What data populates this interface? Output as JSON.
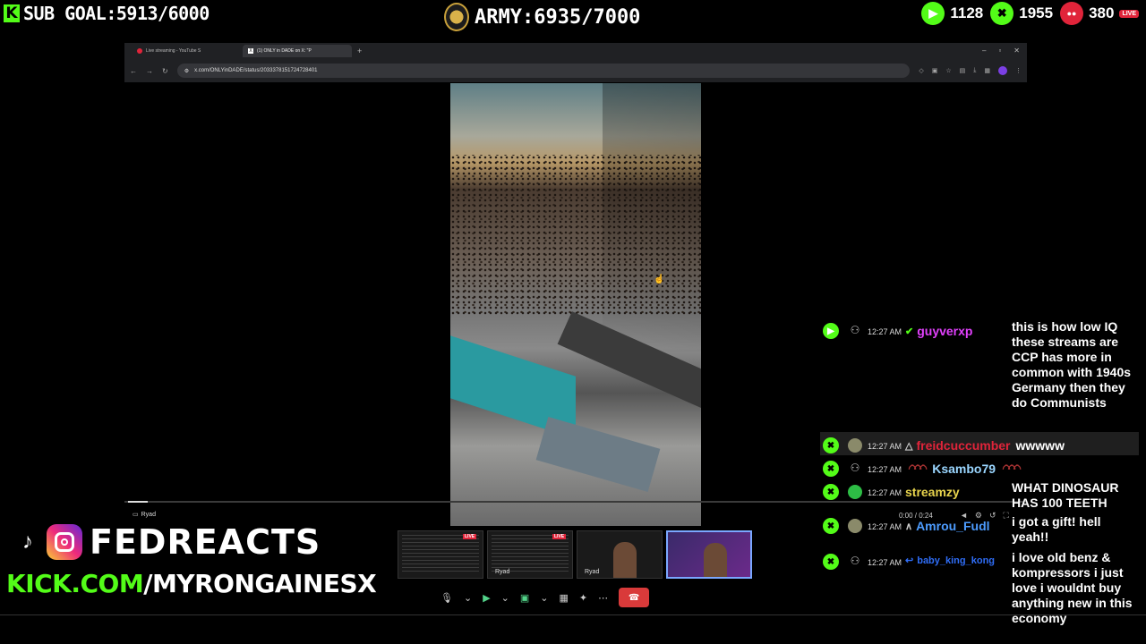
{
  "overlay": {
    "sub_goal": "SUB GOAL:5913/6000",
    "army": "ARMY:6935/7000",
    "youtube_count": "1128",
    "kick_count": "1955",
    "other_count": "380",
    "live_label": "LIVE"
  },
  "browser": {
    "tabs": [
      {
        "label": "Live streaming - YouTube S"
      },
      {
        "label": "(1) ONLY in DADE on X: \"P"
      }
    ],
    "url": "x.com/ONLYinDADE/status/2033378151724728401"
  },
  "video": {
    "time": "0:00 / 0:24"
  },
  "presenter": {
    "label": "Ryad"
  },
  "brand": {
    "handle": "FEDREACTS",
    "kick_domain": "KICK.COM",
    "kick_path": "/MYRONGAINESX"
  },
  "call": {
    "thumbs": [
      {
        "label": "",
        "live": "LIVE"
      },
      {
        "label": "Ryad",
        "live": "LIVE"
      },
      {
        "label": "Ryad",
        "live": ""
      },
      {
        "label": "",
        "live": ""
      }
    ]
  },
  "chat": {
    "messages": [
      {
        "platform": "youtube",
        "time": "12:27 AM",
        "user": "guyverxp",
        "color": "#e040fb",
        "text": "this is how low IQ these streams are CCP has more in common with 1940s Germany then they do Communists"
      },
      {
        "platform": "kick",
        "time": "12:27 AM",
        "user": "freidcuccumber",
        "color": "#e0243a",
        "text": "wwwww"
      },
      {
        "platform": "kick",
        "time": "12:27 AM",
        "user": "Ksambo79",
        "color": "#9ad6ff",
        "text": ""
      },
      {
        "platform": "kick",
        "time": "12:27 AM",
        "user": "streamzy",
        "color": "#e8d44d",
        "text": "WHAT DINOSAUR HAS 100 TEETH"
      },
      {
        "platform": "kick",
        "time": "12:27 AM",
        "user": "Amrou_Fudl",
        "color": "#4d9cff",
        "text": "i got a gift! hell yeah!!"
      },
      {
        "platform": "kick",
        "time": "12:27 AM",
        "user": "baby_king_kong",
        "color": "#2f6df6",
        "text": "i love old benz & kompressors i just love i wouldnt buy anything new in this economy"
      }
    ]
  }
}
